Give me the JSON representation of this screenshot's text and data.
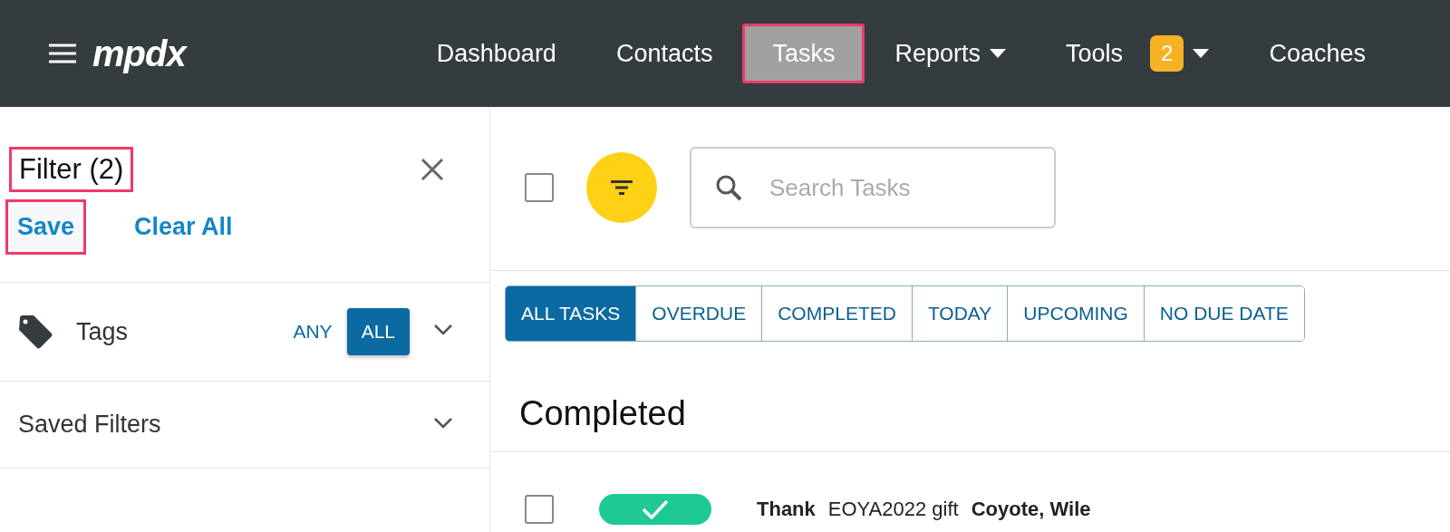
{
  "nav": {
    "logo": "mpdx",
    "items": [
      {
        "label": "Dashboard",
        "selected": false,
        "highlighted": false,
        "dropdown": false
      },
      {
        "label": "Contacts",
        "selected": false,
        "highlighted": false,
        "dropdown": false
      },
      {
        "label": "Tasks",
        "selected": true,
        "highlighted": true,
        "dropdown": false
      },
      {
        "label": "Reports",
        "selected": false,
        "highlighted": false,
        "dropdown": true
      },
      {
        "label": "Tools",
        "selected": false,
        "highlighted": false,
        "dropdown": true,
        "badge": "2"
      },
      {
        "label": "Coaches",
        "selected": false,
        "highlighted": false,
        "dropdown": false
      }
    ]
  },
  "filter": {
    "title": "Filter (2)",
    "title_highlighted": true,
    "save": "Save",
    "save_highlighted": true,
    "clear": "Clear All",
    "sections": [
      {
        "kind": "tags",
        "label": "Tags",
        "expanded": false,
        "options": [
          {
            "label": "ANY",
            "selected": false
          },
          {
            "label": "ALL",
            "selected": true
          }
        ]
      },
      {
        "kind": "plain",
        "label": "Saved Filters",
        "expanded": false
      }
    ]
  },
  "main": {
    "select_all_checked": false,
    "search": {
      "placeholder": "Search Tasks"
    },
    "tabs": [
      {
        "label": "ALL TASKS",
        "selected": true
      },
      {
        "label": "OVERDUE",
        "selected": false
      },
      {
        "label": "COMPLETED",
        "selected": false
      },
      {
        "label": "TODAY",
        "selected": false
      },
      {
        "label": "UPCOMING",
        "selected": false
      },
      {
        "label": "NO DUE DATE",
        "selected": false
      }
    ],
    "section_title": "Completed",
    "tasks": [
      {
        "checked": false,
        "completed": true,
        "action": "Thank",
        "subject": "EOYA2022 gift",
        "contact": "Coyote, Wile"
      }
    ]
  }
}
